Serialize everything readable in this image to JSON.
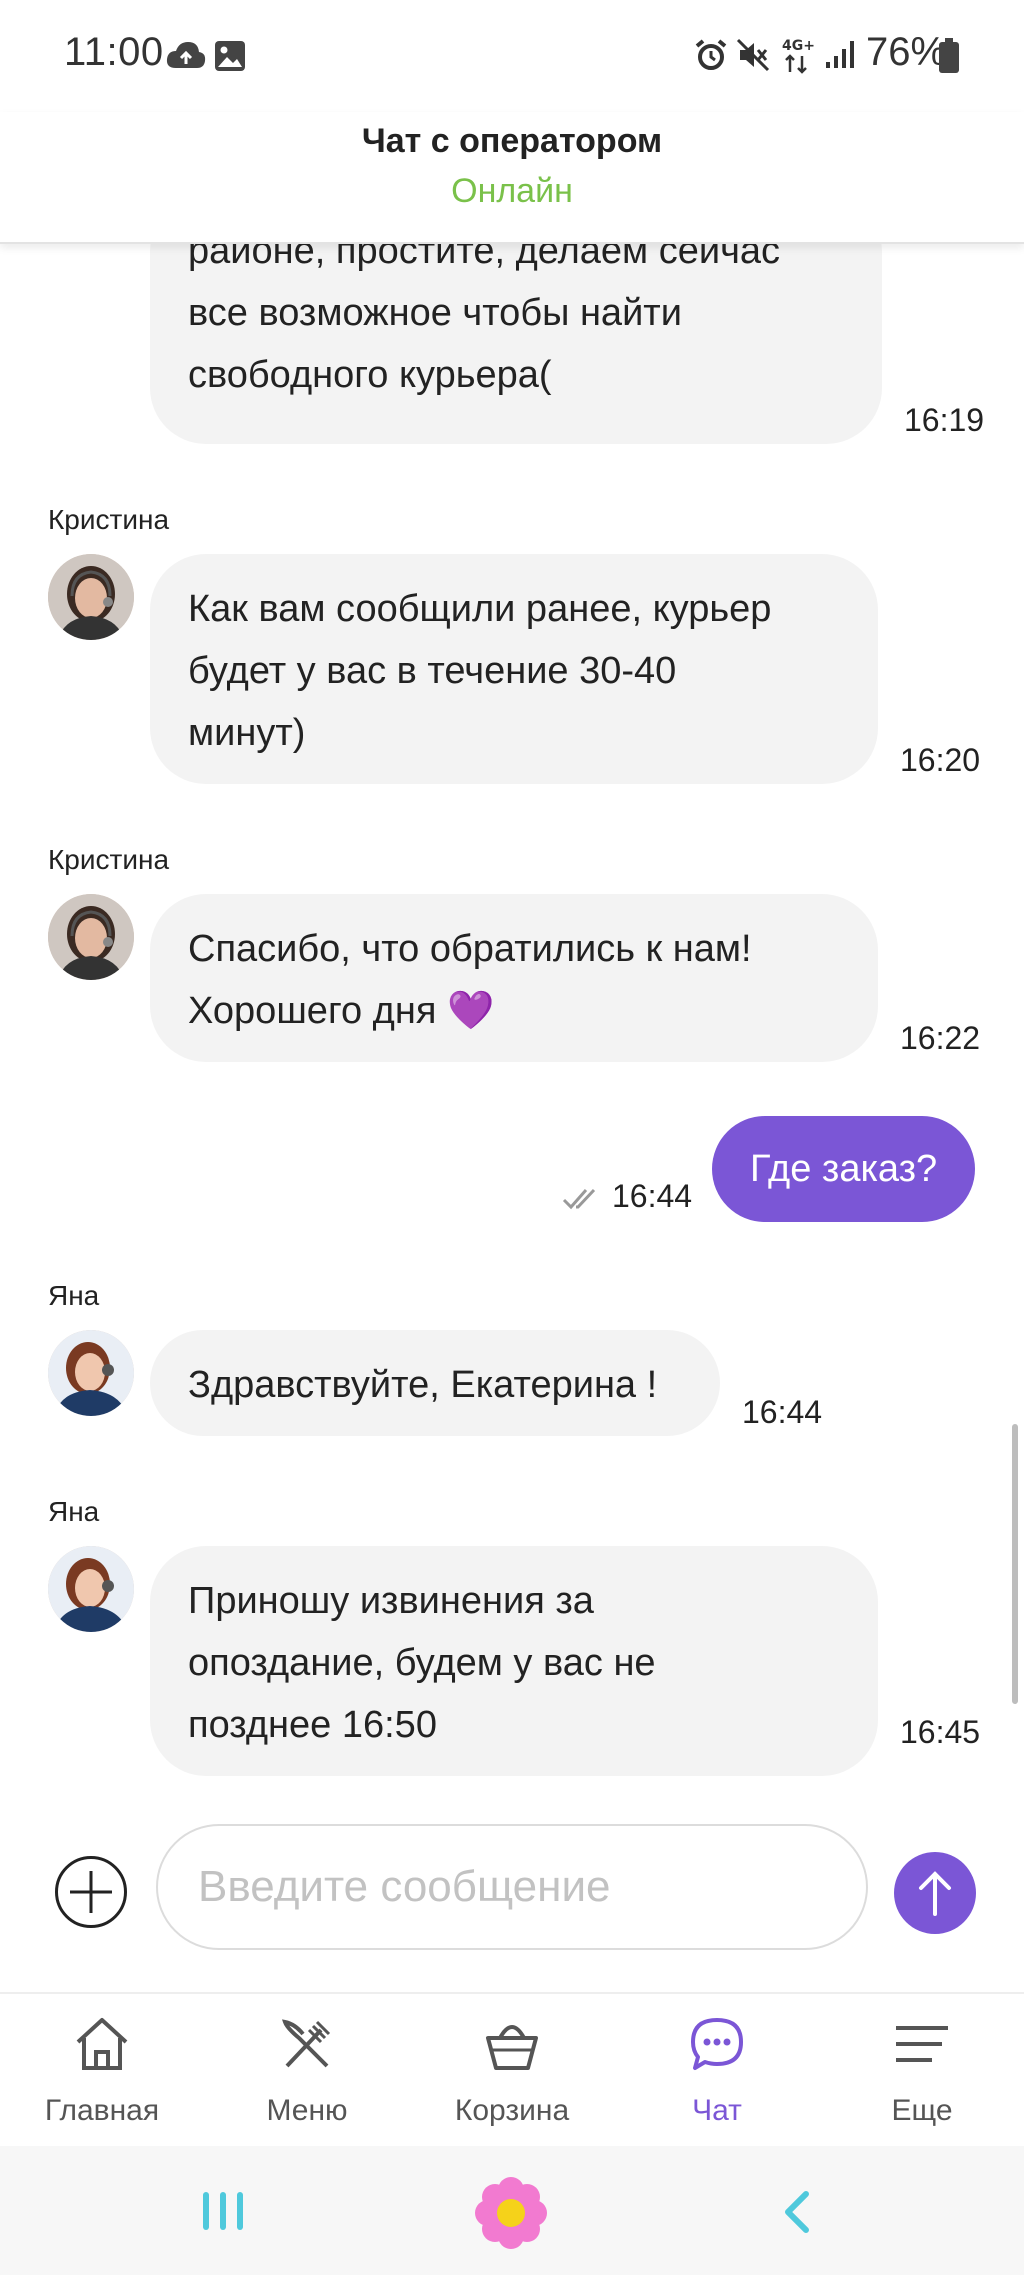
{
  "status_bar": {
    "time": "11:00",
    "battery": "76%"
  },
  "header": {
    "title": "Чат с оператором",
    "status": "Онлайн",
    "status_color": "#7ac14a"
  },
  "messages": [
    {
      "type": "incoming",
      "sender": "",
      "lines": [
        "районе, простите, делаем сейчас",
        "все возможное чтобы найти",
        "свободного курьера("
      ],
      "time": "16:19"
    },
    {
      "type": "incoming",
      "sender": "Кристина",
      "lines": [
        "Как вам сообщили ранее, курьер",
        "будет у вас в течение 30-40",
        "минут)"
      ],
      "time": "16:20"
    },
    {
      "type": "incoming",
      "sender": "Кристина",
      "lines": [
        "Спасибо, что обратились к нам!",
        "Хорошего дня 💜"
      ],
      "time": "16:22"
    },
    {
      "type": "outgoing",
      "text": "Где заказ?",
      "time": "16:44",
      "read": true
    },
    {
      "type": "incoming",
      "sender": "Яна",
      "lines": [
        "Здравствуйте, Екатерина !"
      ],
      "time": "16:44"
    },
    {
      "type": "incoming",
      "sender": "Яна",
      "lines": [
        "Приношу извинения за",
        "опоздание, будем у вас не",
        "позднее  16:50"
      ],
      "time": "16:45"
    }
  ],
  "composer": {
    "placeholder": "Введите сообщение"
  },
  "nav": {
    "items": [
      {
        "label": "Главная",
        "icon": "home-icon"
      },
      {
        "label": "Меню",
        "icon": "fork-knife-icon"
      },
      {
        "label": "Корзина",
        "icon": "basket-icon"
      },
      {
        "label": "Чат",
        "icon": "chat-icon",
        "active": true
      },
      {
        "label": "Еще",
        "icon": "menu-lines-icon"
      }
    ]
  },
  "colors": {
    "accent": "#7b56d6",
    "online": "#7ac14a",
    "bubble_incoming": "#f3f3f3"
  }
}
